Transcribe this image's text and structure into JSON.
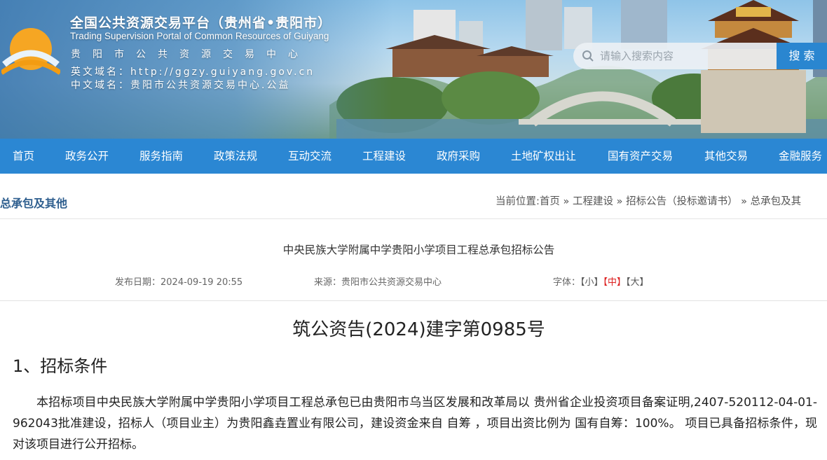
{
  "header": {
    "title": "全国公共资源交易平台（贵州省•贵阳市）",
    "subtitle": "Trading Supervision Portal of Common Resources of Guiyang",
    "center_name": "贵阳市公共资源交易中心",
    "en_domain_label": "英文域名：",
    "en_domain": "http://ggzy.guiyang.gov.cn",
    "cn_domain_label": "中文域名：",
    "cn_domain": "贵阳市公共资源交易中心.公益"
  },
  "search": {
    "placeholder": "请输入搜索内容",
    "button_label": "搜 索"
  },
  "nav": {
    "items": [
      {
        "label": "首页"
      },
      {
        "label": "政务公开"
      },
      {
        "label": "服务指南"
      },
      {
        "label": "政策法规"
      },
      {
        "label": "互动交流"
      },
      {
        "label": "工程建设"
      },
      {
        "label": "政府采购"
      },
      {
        "label": "土地矿权出让"
      },
      {
        "label": "国有资产交易"
      },
      {
        "label": "其他交易"
      },
      {
        "label": "金融服务"
      }
    ]
  },
  "location": {
    "section_title": "总承包及其他",
    "prefix": "当前位置:",
    "crumbs": [
      "首页",
      "工程建设",
      "招标公告（投标邀请书）",
      "总承包及其"
    ],
    "separator": " » "
  },
  "article": {
    "title": "中央民族大学附属中学贵阳小学项目工程总承包招标公告",
    "date_label": "发布日期：",
    "date": "2024-09-19 20:55",
    "source_label": "来源：",
    "source": "贵阳市公共资源交易中心",
    "font_label": "字体：",
    "font_small": "【小】",
    "font_medium": "【中】",
    "font_large": "【大】",
    "doc_number": "筑公资告(2024)建字第0985号",
    "section1_heading": "1、招标条件",
    "section1_text": "本招标项目中央民族大学附属中学贵阳小学项目工程总承包已由贵阳市乌当区发展和改革局以 贵州省企业投资项目备案证明,2407-520112-04-01-962043批准建设，招标人（项目业主）为贵阳鑫垚置业有限公司，建设资金来自 自筹 ，项目出资比例为 国有自筹：100%。 项目已具备招标条件，现对该项目进行公开招标。"
  },
  "colors": {
    "nav_bg": "#2b87d3",
    "search_button": "#2a86d0",
    "section_title": "#2f5f8f",
    "font_active": "#dd2222"
  },
  "icons": {
    "logo": "sunrise-logo-icon",
    "search": "search-icon"
  }
}
